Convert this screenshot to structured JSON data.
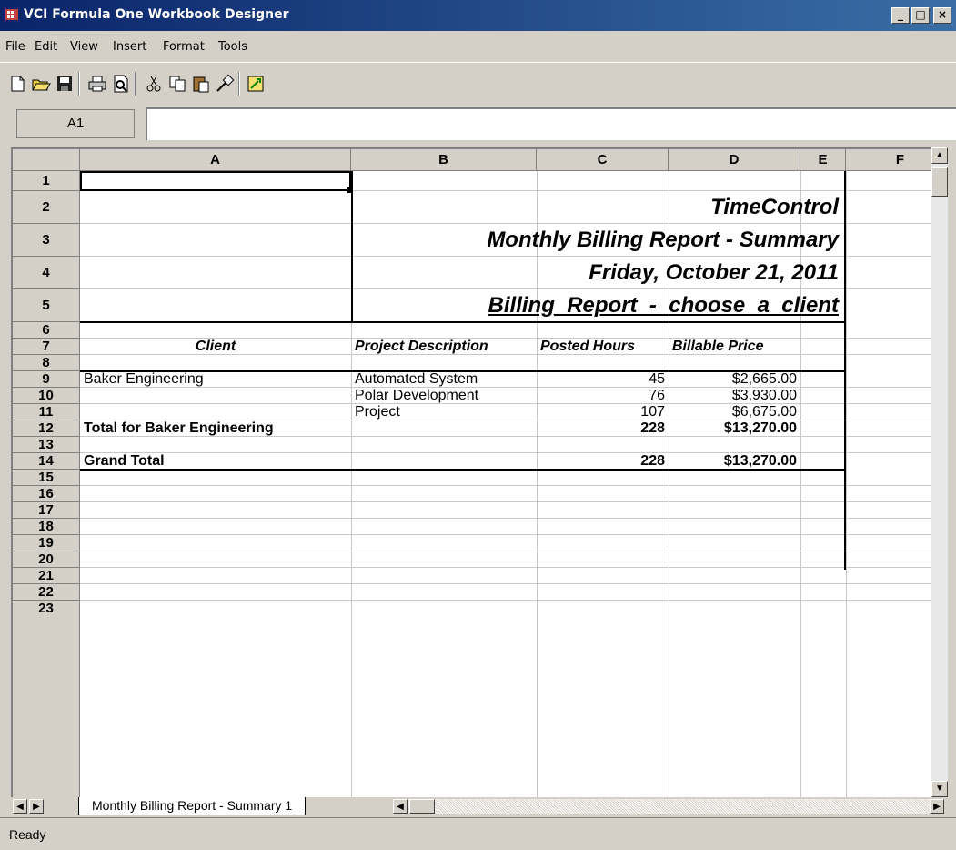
{
  "window": {
    "title": "VCI Formula One Workbook Designer"
  },
  "menu": [
    "File",
    "Edit",
    "View",
    "Insert",
    "Format",
    "Tools"
  ],
  "toolbar": [
    "new-icon",
    "open-icon",
    "save-icon",
    "print-icon",
    "print-preview-icon",
    "cut-icon",
    "copy-icon",
    "paste-icon",
    "format-painter-icon",
    "wizard-icon"
  ],
  "formula_bar": {
    "cell_ref": "A1",
    "value": ""
  },
  "columns": [
    "A",
    "B",
    "C",
    "D",
    "E",
    "F"
  ],
  "rows": [
    "1",
    "2",
    "3",
    "4",
    "5",
    "6",
    "7",
    "8",
    "9",
    "10",
    "11",
    "12",
    "13",
    "14",
    "15",
    "16",
    "17",
    "18",
    "19",
    "20",
    "21",
    "22",
    "23"
  ],
  "report": {
    "company": "TimeControl",
    "title": "Monthly Billing Report - Summary",
    "date": "Friday, October 21, 2011",
    "report_name": "Billing_Report_-_choose_a_client",
    "headers": {
      "client": "Client",
      "project": "Project Description",
      "hours": "Posted Hours",
      "price": "Billable Price"
    },
    "lines": [
      {
        "client": "Baker Engineering",
        "project": "Automated System",
        "hours": "45",
        "price": "$2,665.00"
      },
      {
        "client": "",
        "project": "Polar Development",
        "hours": "76",
        "price": "$3,930.00"
      },
      {
        "client": "",
        "project": "Project",
        "hours": "107",
        "price": "$6,675.00"
      }
    ],
    "subtotal": {
      "label": "Total for Baker Engineering",
      "hours": "228",
      "price": "$13,270.00"
    },
    "grand_total": {
      "label": "Grand Total",
      "hours": "228",
      "price": "$13,270.00"
    }
  },
  "sheet_tab": "Monthly Billing Report - Summary 1",
  "status": "Ready"
}
